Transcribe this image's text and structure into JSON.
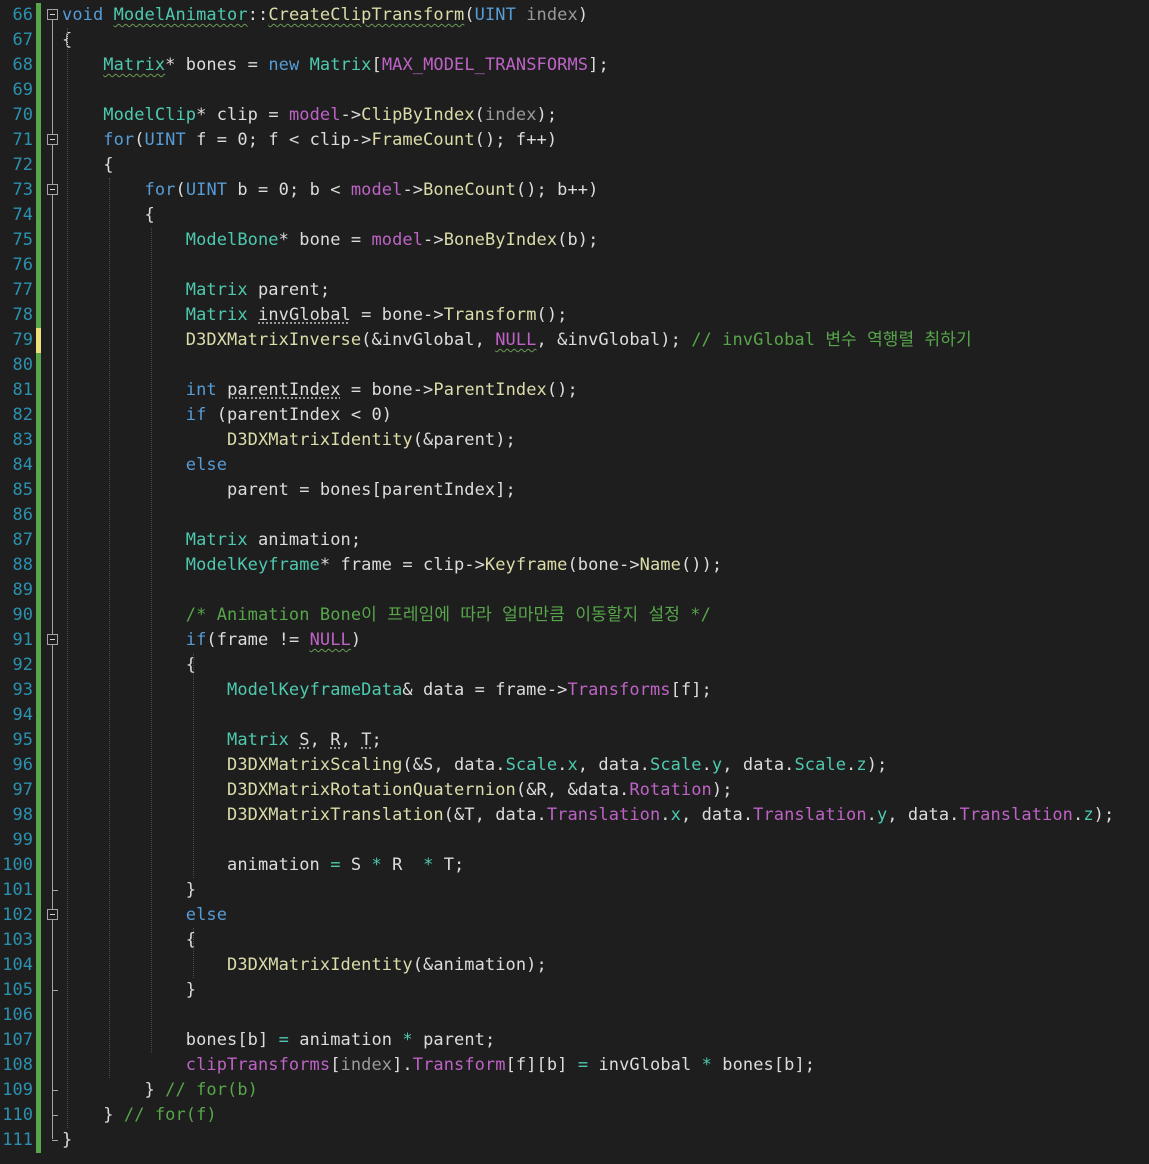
{
  "editor": {
    "title": "ModelAnimator::CreateClipTransform",
    "colors": {
      "background": "#1e1e1e",
      "line_number": "#2b91af",
      "keyword": "#569cd6",
      "type": "#4ec9b0",
      "function": "#dcdcaa",
      "macro": "#bd63c5",
      "comment": "#57a64a",
      "change_saved": "#57a64a",
      "change_modified": "#efe07a"
    },
    "lines": [
      {
        "n": "66",
        "tokens": [
          [
            "k",
            "void"
          ],
          [
            "d",
            " "
          ],
          [
            "t",
            "ModelAnimator",
            "g"
          ],
          [
            "d",
            "::"
          ],
          [
            "f",
            "CreateClipTransform",
            "g"
          ],
          [
            "d",
            "("
          ],
          [
            "k",
            "UINT"
          ],
          [
            "d",
            " "
          ],
          [
            "p",
            "index"
          ],
          [
            "d",
            ")"
          ]
        ]
      },
      {
        "n": "67",
        "tokens": [
          [
            "d",
            "{"
          ]
        ]
      },
      {
        "n": "68",
        "tokens": [
          [
            "d",
            "    "
          ],
          [
            "t",
            "Matrix",
            "g"
          ],
          [
            "d",
            "* bones = "
          ],
          [
            "k",
            "new"
          ],
          [
            "d",
            " "
          ],
          [
            "t",
            "Matrix"
          ],
          [
            "d",
            "["
          ],
          [
            "m",
            "MAX_MODEL_TRANSFORMS"
          ],
          [
            "d",
            "];"
          ]
        ]
      },
      {
        "n": "69",
        "tokens": []
      },
      {
        "n": "70",
        "tokens": [
          [
            "d",
            "    "
          ],
          [
            "t",
            "ModelClip"
          ],
          [
            "d",
            "* clip = "
          ],
          [
            "m",
            "model"
          ],
          [
            "d",
            "->"
          ],
          [
            "f",
            "ClipByIndex"
          ],
          [
            "d",
            "("
          ],
          [
            "p",
            "index"
          ],
          [
            "d",
            ");"
          ]
        ]
      },
      {
        "n": "71",
        "tokens": [
          [
            "d",
            "    "
          ],
          [
            "k",
            "for"
          ],
          [
            "d",
            "("
          ],
          [
            "k",
            "UINT"
          ],
          [
            "d",
            " f = 0; f < clip->"
          ],
          [
            "f",
            "FrameCount"
          ],
          [
            "d",
            "(); f++)"
          ]
        ]
      },
      {
        "n": "72",
        "tokens": [
          [
            "d",
            "    {"
          ]
        ]
      },
      {
        "n": "73",
        "tokens": [
          [
            "d",
            "        "
          ],
          [
            "k",
            "for"
          ],
          [
            "d",
            "("
          ],
          [
            "k",
            "UINT"
          ],
          [
            "d",
            " b = 0; b < "
          ],
          [
            "m",
            "model"
          ],
          [
            "d",
            "->"
          ],
          [
            "f",
            "BoneCount"
          ],
          [
            "d",
            "(); b++)"
          ]
        ]
      },
      {
        "n": "74",
        "tokens": [
          [
            "d",
            "        {"
          ]
        ]
      },
      {
        "n": "75",
        "tokens": [
          [
            "d",
            "            "
          ],
          [
            "t",
            "ModelBone"
          ],
          [
            "d",
            "* bone = "
          ],
          [
            "m",
            "model"
          ],
          [
            "d",
            "->"
          ],
          [
            "f",
            "BoneByIndex"
          ],
          [
            "d",
            "(b);"
          ]
        ]
      },
      {
        "n": "76",
        "tokens": []
      },
      {
        "n": "77",
        "tokens": [
          [
            "d",
            "            "
          ],
          [
            "t",
            "Matrix"
          ],
          [
            "d",
            " parent;"
          ]
        ]
      },
      {
        "n": "78",
        "tokens": [
          [
            "d",
            "            "
          ],
          [
            "t",
            "Matrix"
          ],
          [
            "d",
            " "
          ],
          [
            "d",
            "invGlobal",
            "dot"
          ],
          [
            "d",
            " = bone->"
          ],
          [
            "f",
            "Transform"
          ],
          [
            "d",
            "();"
          ]
        ]
      },
      {
        "n": "79",
        "tokens": [
          [
            "d",
            "            "
          ],
          [
            "f",
            "D3DXMatrixInverse"
          ],
          [
            "d",
            "(&invGlobal, "
          ],
          [
            "m",
            "NULL",
            "g"
          ],
          [
            "d",
            ", &invGlobal); "
          ],
          [
            "c",
            "// invGlobal 변수 역행렬 취하기"
          ]
        ]
      },
      {
        "n": "80",
        "tokens": []
      },
      {
        "n": "81",
        "tokens": [
          [
            "d",
            "            "
          ],
          [
            "k",
            "int"
          ],
          [
            "d",
            " "
          ],
          [
            "d",
            "parentIndex",
            "dot"
          ],
          [
            "d",
            " = bone->"
          ],
          [
            "f",
            "ParentIndex"
          ],
          [
            "d",
            "();"
          ]
        ]
      },
      {
        "n": "82",
        "tokens": [
          [
            "d",
            "            "
          ],
          [
            "k",
            "if"
          ],
          [
            "d",
            " (parentIndex < 0)"
          ]
        ]
      },
      {
        "n": "83",
        "tokens": [
          [
            "d",
            "                "
          ],
          [
            "f",
            "D3DXMatrixIdentity"
          ],
          [
            "d",
            "(&parent);"
          ]
        ]
      },
      {
        "n": "84",
        "tokens": [
          [
            "d",
            "            "
          ],
          [
            "k",
            "else"
          ]
        ]
      },
      {
        "n": "85",
        "tokens": [
          [
            "d",
            "                parent = bones[parentIndex];"
          ]
        ]
      },
      {
        "n": "86",
        "tokens": []
      },
      {
        "n": "87",
        "tokens": [
          [
            "d",
            "            "
          ],
          [
            "t",
            "Matrix"
          ],
          [
            "d",
            " animation;"
          ]
        ]
      },
      {
        "n": "88",
        "tokens": [
          [
            "d",
            "            "
          ],
          [
            "t",
            "ModelKeyframe"
          ],
          [
            "d",
            "* frame = clip->"
          ],
          [
            "f",
            "Keyframe"
          ],
          [
            "d",
            "(bone->"
          ],
          [
            "f",
            "Name"
          ],
          [
            "d",
            "());"
          ]
        ]
      },
      {
        "n": "89",
        "tokens": []
      },
      {
        "n": "90",
        "tokens": [
          [
            "d",
            "            "
          ],
          [
            "c",
            "/* Animation Bone이 프레임에 따라 얼마만큼 이동할지 설정 */"
          ]
        ]
      },
      {
        "n": "91",
        "tokens": [
          [
            "d",
            "            "
          ],
          [
            "k",
            "if"
          ],
          [
            "d",
            "(frame != "
          ],
          [
            "m",
            "NULL",
            "g"
          ],
          [
            "d",
            ")"
          ]
        ]
      },
      {
        "n": "92",
        "tokens": [
          [
            "d",
            "            {"
          ]
        ]
      },
      {
        "n": "93",
        "tokens": [
          [
            "d",
            "                "
          ],
          [
            "t",
            "ModelKeyframeData"
          ],
          [
            "d",
            "& data = frame->"
          ],
          [
            "m",
            "Transforms"
          ],
          [
            "d",
            "[f];"
          ]
        ]
      },
      {
        "n": "94",
        "tokens": []
      },
      {
        "n": "95",
        "tokens": [
          [
            "d",
            "                "
          ],
          [
            "t",
            "Matrix"
          ],
          [
            "d",
            " "
          ],
          [
            "d",
            "S",
            "dot"
          ],
          [
            "d",
            ", "
          ],
          [
            "d",
            "R",
            "dot"
          ],
          [
            "d",
            ", "
          ],
          [
            "d",
            "T",
            "dot"
          ],
          [
            "d",
            ";"
          ]
        ]
      },
      {
        "n": "96",
        "tokens": [
          [
            "d",
            "                "
          ],
          [
            "f",
            "D3DXMatrixScaling"
          ],
          [
            "d",
            "(&S, data."
          ],
          [
            "t",
            "Scale"
          ],
          [
            "d",
            "."
          ],
          [
            "t",
            "x"
          ],
          [
            "d",
            ", data."
          ],
          [
            "t",
            "Scale"
          ],
          [
            "d",
            "."
          ],
          [
            "t",
            "y"
          ],
          [
            "d",
            ", data."
          ],
          [
            "t",
            "Scale"
          ],
          [
            "d",
            "."
          ],
          [
            "t",
            "z"
          ],
          [
            "d",
            ");"
          ]
        ]
      },
      {
        "n": "97",
        "tokens": [
          [
            "d",
            "                "
          ],
          [
            "f",
            "D3DXMatrixRotationQuaternion"
          ],
          [
            "d",
            "(&R, &data."
          ],
          [
            "m",
            "Rotation"
          ],
          [
            "d",
            ");"
          ]
        ]
      },
      {
        "n": "98",
        "tokens": [
          [
            "d",
            "                "
          ],
          [
            "f",
            "D3DXMatrixTranslation"
          ],
          [
            "d",
            "(&T, data."
          ],
          [
            "m",
            "Translation"
          ],
          [
            "d",
            "."
          ],
          [
            "t",
            "x"
          ],
          [
            "d",
            ", data."
          ],
          [
            "m",
            "Translation"
          ],
          [
            "d",
            "."
          ],
          [
            "t",
            "y"
          ],
          [
            "d",
            ", data."
          ],
          [
            "m",
            "Translation"
          ],
          [
            "d",
            "."
          ],
          [
            "t",
            "z"
          ],
          [
            "d",
            ");"
          ]
        ]
      },
      {
        "n": "99",
        "tokens": []
      },
      {
        "n": "100",
        "tokens": [
          [
            "d",
            "                animation "
          ],
          [
            "t",
            "="
          ],
          [
            "d",
            " S "
          ],
          [
            "t",
            "*"
          ],
          [
            "d",
            " R  "
          ],
          [
            "t",
            "*"
          ],
          [
            "d",
            " T;"
          ]
        ]
      },
      {
        "n": "101",
        "tokens": [
          [
            "d",
            "            }"
          ]
        ]
      },
      {
        "n": "102",
        "tokens": [
          [
            "d",
            "            "
          ],
          [
            "k",
            "else"
          ]
        ]
      },
      {
        "n": "103",
        "tokens": [
          [
            "d",
            "            {"
          ]
        ]
      },
      {
        "n": "104",
        "tokens": [
          [
            "d",
            "                "
          ],
          [
            "f",
            "D3DXMatrixIdentity"
          ],
          [
            "d",
            "(&animation);"
          ]
        ]
      },
      {
        "n": "105",
        "tokens": [
          [
            "d",
            "            }"
          ]
        ]
      },
      {
        "n": "106",
        "tokens": []
      },
      {
        "n": "107",
        "tokens": [
          [
            "d",
            "            bones[b] "
          ],
          [
            "t",
            "="
          ],
          [
            "d",
            " animation "
          ],
          [
            "t",
            "*"
          ],
          [
            "d",
            " parent;"
          ]
        ]
      },
      {
        "n": "108",
        "tokens": [
          [
            "d",
            "            "
          ],
          [
            "m",
            "clipTransforms"
          ],
          [
            "d",
            "["
          ],
          [
            "p",
            "index"
          ],
          [
            "d",
            "]."
          ],
          [
            "m",
            "Transform"
          ],
          [
            "d",
            "[f][b] "
          ],
          [
            "t",
            "="
          ],
          [
            "d",
            " invGlobal "
          ],
          [
            "t",
            "*"
          ],
          [
            "d",
            " bones[b];"
          ]
        ]
      },
      {
        "n": "109",
        "tokens": [
          [
            "d",
            "        } "
          ],
          [
            "c",
            "// for(b)"
          ]
        ]
      },
      {
        "n": "110",
        "tokens": [
          [
            "d",
            "    } "
          ],
          [
            "c",
            "// for(f)"
          ]
        ]
      },
      {
        "n": "111",
        "tokens": [
          [
            "d",
            "}"
          ]
        ]
      }
    ]
  }
}
